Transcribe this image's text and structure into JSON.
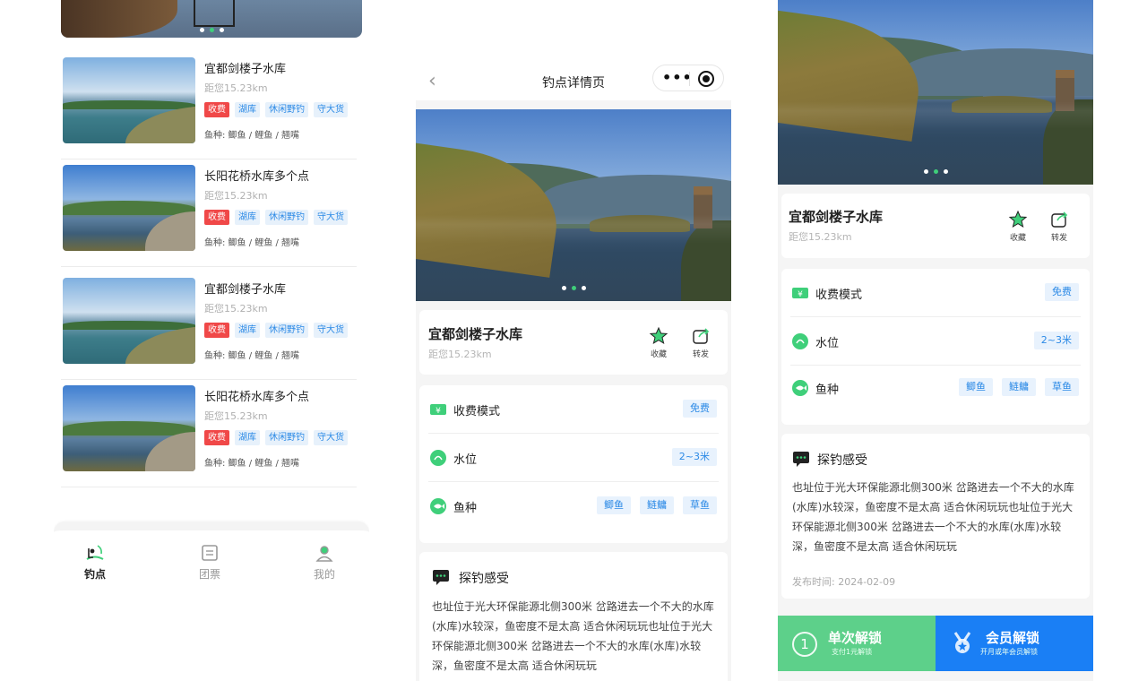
{
  "list_screen": {
    "banner": {
      "dot_count": 3,
      "active_dot": 1
    },
    "spots": [
      {
        "title": "宜都剑楼子水库",
        "distance": "距您15.23km",
        "fee_tag": "收费",
        "tags": [
          "湖库",
          "休闲野钓",
          "守大货"
        ],
        "fish": "鱼种: 鲫鱼 / 鲤鱼 / 翘嘴"
      },
      {
        "title": "长阳花桥水库多个点",
        "distance": "距您15.23km",
        "fee_tag": "收费",
        "tags": [
          "湖库",
          "休闲野钓",
          "守大货"
        ],
        "fish": "鱼种: 鲫鱼 / 鲤鱼 / 翘嘴"
      },
      {
        "title": "宜都剑楼子水库",
        "distance": "距您15.23km",
        "fee_tag": "收费",
        "tags": [
          "湖库",
          "休闲野钓",
          "守大货"
        ],
        "fish": "鱼种: 鲫鱼 / 鲤鱼 / 翘嘴"
      },
      {
        "title": "长阳花桥水库多个点",
        "distance": "距您15.23km",
        "fee_tag": "收费",
        "tags": [
          "湖库",
          "休闲野钓",
          "守大货"
        ],
        "fish": "鱼种: 鲫鱼 / 鲤鱼 / 翘嘴"
      }
    ],
    "tabbar": [
      {
        "label": "钓点",
        "icon": "fishing-spot-icon",
        "active": true
      },
      {
        "label": "团票",
        "icon": "ticket-icon",
        "active": false
      },
      {
        "label": "我的",
        "icon": "user-icon",
        "active": false
      }
    ]
  },
  "detail_screen": {
    "nav": {
      "title": "钓点详情页",
      "back_icon": "chevron-left-icon",
      "more_icon": "more-icon",
      "close_icon": "target-icon"
    },
    "carousel": {
      "dot_count": 3,
      "active_dot": 1
    },
    "spot": {
      "name": "宜都剑楼子水库",
      "distance": "距您15.23km"
    },
    "actions": {
      "favorite": "收藏",
      "share": "转发"
    },
    "info": {
      "fee_label": "收费模式",
      "fee_value": "免费",
      "water_label": "水位",
      "water_value": "2~3米",
      "fish_label": "鱼种",
      "fish_values": [
        "鲫鱼",
        "鲢鳙",
        "草鱼"
      ]
    },
    "experience": {
      "title": "探钓感受",
      "text": "也址位于光大环保能源北侧300米 岔路进去一个不大的水库(水库)水较深，鱼密度不是太高 适合休闲玩玩也址位于光大环保能源北侧300米 岔路进去一个不大的水库(水库)水较深，鱼密度不是太高 适合休闲玩玩"
    }
  },
  "unlock_screen": {
    "spot": {
      "name": "宜都剑楼子水库",
      "distance": "距您15.23km"
    },
    "actions": {
      "favorite": "收藏",
      "share": "转发"
    },
    "info": {
      "fee_label": "收费模式",
      "fee_value": "免费",
      "water_label": "水位",
      "water_value": "2~3米",
      "fish_label": "鱼种",
      "fish_values": [
        "鲫鱼",
        "鲢鳙",
        "草鱼"
      ]
    },
    "experience": {
      "title": "探钓感受",
      "text": "也址位于光大环保能源北侧300米 岔路进去一个不大的水库(水库)水较深，鱼密度不是太高 适合休闲玩玩也址位于光大环保能源北侧300米 岔路进去一个不大的水库(水库)水较深，鱼密度不是太高 适合休闲玩玩",
      "published": "发布时间: 2024-02-09"
    },
    "unlock": {
      "single_title": "单次解锁",
      "single_sub": "支付1元解锁",
      "single_icon_text": "1",
      "member_title": "会员解锁",
      "member_sub": "开月或年会员解锁"
    }
  },
  "colors": {
    "accent_green": "#3fcf7a",
    "fee_red": "#f04848",
    "chip_blue": "#2c8ae6",
    "member_blue": "#1a7ff5"
  }
}
